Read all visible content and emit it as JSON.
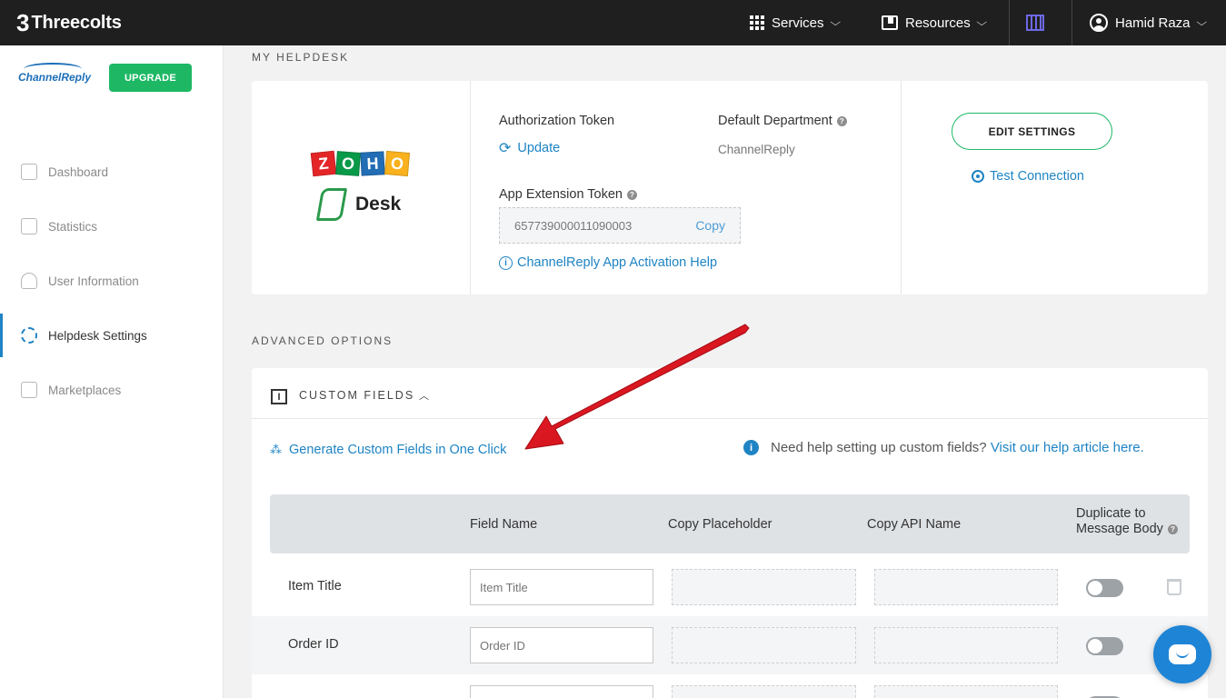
{
  "topbar": {
    "brand": "Threecolts",
    "brand_mark": "3",
    "services": "Services",
    "resources": "Resources",
    "user": "Hamid Raza",
    "chevron": "⌵"
  },
  "sidebar": {
    "logo": "ChannelReply",
    "upgrade": "UPGRADE",
    "items": [
      {
        "label": "Dashboard",
        "icon": "home-icon"
      },
      {
        "label": "Statistics",
        "icon": "clipboard-icon"
      },
      {
        "label": "User Information",
        "icon": "user-icon"
      },
      {
        "label": "Helpdesk Settings",
        "icon": "gear-icon"
      },
      {
        "label": "Marketplaces",
        "icon": "store-icon"
      }
    ]
  },
  "helpdesk": {
    "section_title": "MY HELPDESK",
    "zoho_letters": [
      "Z",
      "O",
      "H",
      "O"
    ],
    "zoho_colors": [
      "#e42527",
      "#089949",
      "#226db4",
      "#f9b21d"
    ],
    "desk_label": "Desk",
    "auth_token_label": "Authorization Token",
    "update_link": "Update",
    "default_dept_label": "Default Department",
    "default_dept_value": "ChannelReply",
    "app_ext_label": "App Extension Token",
    "app_ext_value": "657739000011090003",
    "copy_label": "Copy",
    "activation_help": "ChannelReply App Activation Help",
    "edit_settings": "EDIT SETTINGS",
    "test_connection": "Test Connection"
  },
  "advanced": {
    "section_title": "ADVANCED OPTIONS",
    "custom_fields_title": "CUSTOM FIELDS",
    "generate_link": "Generate Custom Fields in One Click",
    "help_text": "Need help setting up custom fields?",
    "help_link": "Visit our help article here.",
    "columns": [
      "Field Name",
      "Copy Placeholder",
      "Copy API Name",
      "Duplicate to Message Body"
    ],
    "rows": [
      {
        "label": "Item Title",
        "placeholder": "Item Title"
      },
      {
        "label": "Order ID",
        "placeholder": "Order ID"
      },
      {
        "label": "",
        "placeholder": ""
      }
    ]
  },
  "colors": {
    "accent": "#1e84c4",
    "green": "#1eb865",
    "annotation_arrow": "#e0141e"
  }
}
